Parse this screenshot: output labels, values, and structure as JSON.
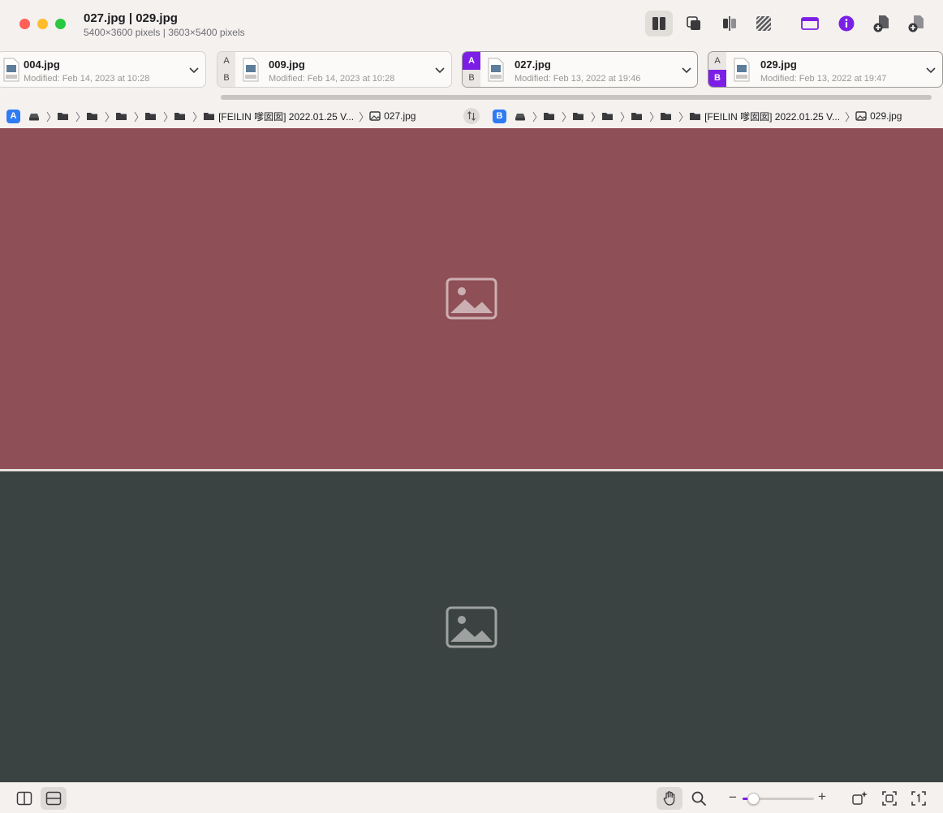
{
  "window": {
    "title": "027.jpg | 029.jpg",
    "subtitle": "5400×3600 pixels | 3603×5400 pixels"
  },
  "toolbar": {
    "buttons": [
      {
        "icon": "side-by-side-icon",
        "active": true
      },
      {
        "icon": "overlay-icon",
        "active": false
      },
      {
        "icon": "split-slider-icon",
        "active": false
      },
      {
        "icon": "difference-hatch-icon",
        "active": false
      },
      {
        "icon": "window-layout-icon",
        "active": false
      },
      {
        "icon": "info-icon",
        "active": false
      },
      {
        "icon": "add-left-file-icon",
        "active": false
      },
      {
        "icon": "add-right-file-icon",
        "active": false
      }
    ],
    "accent": "#7b1fe6"
  },
  "tabs": [
    {
      "name": "004.jpg",
      "modified": "Modified: Feb 14, 2023 at 10:28",
      "a_label": "",
      "b_label": "",
      "selected_side": ""
    },
    {
      "name": "009.jpg",
      "modified": "Modified: Feb 14, 2023 at 10:28",
      "a_label": "A",
      "b_label": "B",
      "selected_side": ""
    },
    {
      "name": "027.jpg",
      "modified": "Modified: Feb 13, 2022 at 19:46",
      "a_label": "A",
      "b_label": "B",
      "selected_side": "A"
    },
    {
      "name": "029.jpg",
      "modified": "Modified: Feb 13, 2022 at 19:47",
      "a_label": "A",
      "b_label": "B",
      "selected_side": "B"
    }
  ],
  "breadcrumbs": {
    "left": {
      "badge": "A",
      "folder_name": "[FEILIN 嗲囡囡] 2022.01.25 V...",
      "file_name": "027.jpg"
    },
    "right": {
      "badge": "B",
      "folder_name": "[FEILIN 嗲囡囡] 2022.01.25 V...",
      "file_name": "029.jpg"
    },
    "swap_icon": "swap-arrows-icon"
  },
  "panes": {
    "a": {
      "file": "027.jpg",
      "placeholder_icon": "image-placeholder-icon"
    },
    "b": {
      "file": "029.jpg",
      "placeholder_icon": "image-placeholder-icon"
    }
  },
  "bottombar": {
    "layout_buttons": [
      {
        "icon": "vertical-split-icon",
        "active": false
      },
      {
        "icon": "horizontal-split-icon",
        "active": true
      }
    ],
    "tools": [
      {
        "icon": "hand-tool-icon",
        "active": true
      },
      {
        "icon": "magnifier-icon",
        "active": false
      }
    ],
    "zoom": {
      "minus": "−",
      "plus": "+",
      "level": 0.15
    },
    "right_buttons": [
      "auto-enhance-icon",
      "fit-to-window-icon",
      "actual-size-icon"
    ]
  }
}
